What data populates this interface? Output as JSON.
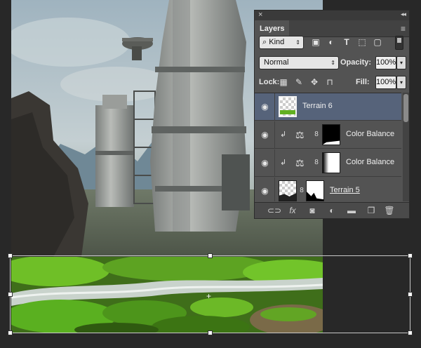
{
  "layers_panel": {
    "close_glyph": "×",
    "collapse_glyph": "◂◂",
    "tab_label": "Layers",
    "menu_glyph": "≡",
    "filter": {
      "kind_label": "Kind",
      "search_glyph": "⌕",
      "arrows_glyph": "⇕",
      "icons": [
        "image-filter-icon",
        "adjustment-filter-icon",
        "type-filter-icon",
        "shape-filter-icon",
        "smart-object-filter-icon"
      ]
    },
    "blend": {
      "mode": "Normal",
      "opacity_label": "Opacity:",
      "opacity_value": "100%",
      "fill_label": "Fill:",
      "fill_value": "100%",
      "dropdown_glyph": "▾"
    },
    "lock": {
      "label": "Lock:",
      "icons": [
        "lock-transparent-pixels-icon",
        "lock-image-pixels-icon",
        "lock-position-icon",
        "lock-all-icon"
      ]
    },
    "layers": [
      {
        "name": "Terrain 6",
        "selected": true,
        "visible": true
      },
      {
        "name": "Color Balance",
        "selected": false,
        "visible": true,
        "clipped": true
      },
      {
        "name": "Color Balance",
        "selected": false,
        "visible": true,
        "clipped": true
      },
      {
        "name": "Terrain 5",
        "selected": false,
        "visible": true
      }
    ],
    "bottom_icons": [
      "link-layers-icon",
      "fx-icon",
      "add-mask-icon",
      "adjustment-layer-icon",
      "new-group-icon",
      "new-layer-icon",
      "delete-icon"
    ],
    "fx_label": "fx"
  },
  "canvas": {
    "transform_center_glyph": "+"
  }
}
